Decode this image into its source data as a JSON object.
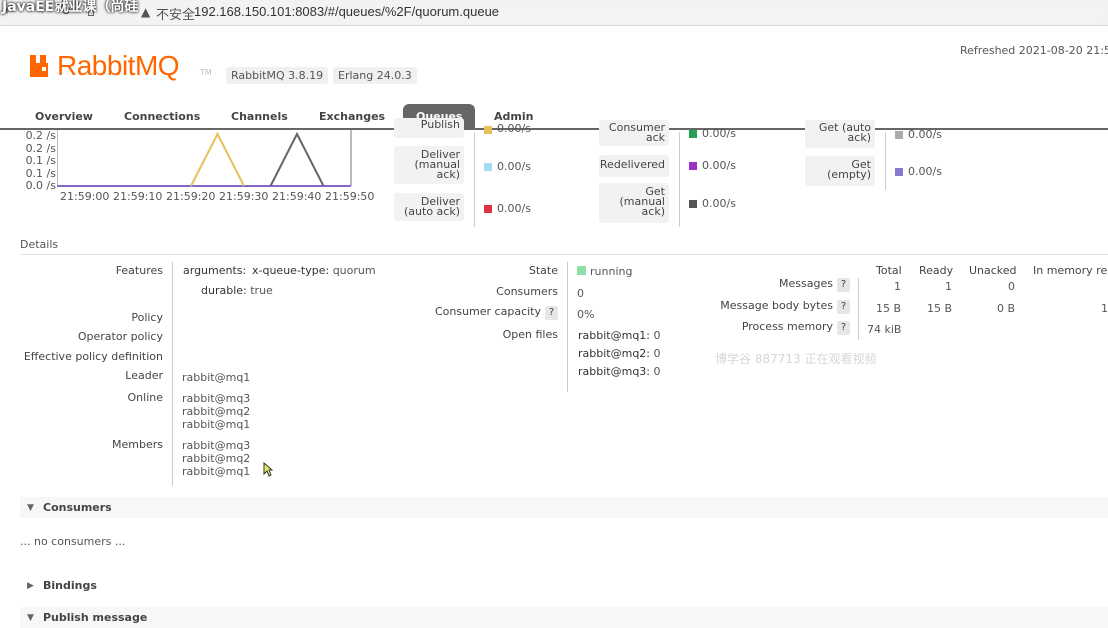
{
  "browser": {
    "overlay_text": "JavaEE就业课（尚硅",
    "security_text": "不安全",
    "url": "192.168.150.101:8083/#/queues/%2F/quorum.queue"
  },
  "header": {
    "brand": "RabbitMQ",
    "tm": "TM",
    "version_rabbit": "RabbitMQ 3.8.19",
    "version_erlang": "Erlang 24.0.3",
    "refreshed": "Refreshed 2021-08-20 21:5"
  },
  "tabs": [
    "Overview",
    "Connections",
    "Channels",
    "Exchanges",
    "Queues",
    "Admin"
  ],
  "active_tab": "Queues",
  "chart_data": {
    "type": "line",
    "y_ticks": [
      "0.2 /s",
      "0.2 /s",
      "0.1 /s",
      "0.1 /s",
      "0.0 /s"
    ],
    "x_ticks": [
      "21:59:00",
      "21:59:10",
      "21:59:20",
      "21:59:30",
      "21:59:40",
      "21:59:50"
    ],
    "series": [
      {
        "color": "#e6c25a",
        "points": [
          [
            "21:59:20",
            0.0
          ],
          [
            "21:59:25",
            0.2
          ],
          [
            "21:59:30",
            0.0
          ]
        ]
      },
      {
        "color": "#666666",
        "points": [
          [
            "21:59:35",
            0.0
          ],
          [
            "21:59:40",
            0.2
          ],
          [
            "21:59:45",
            0.0
          ]
        ]
      }
    ]
  },
  "rates": {
    "col1": [
      {
        "label": "Publish",
        "rate": "0.00/s",
        "color": "#e6c25a"
      },
      {
        "label": "Deliver (manual ack)",
        "rate": "0.00/s",
        "color": "#a6d8f2"
      },
      {
        "label": "Deliver (auto ack)",
        "rate": "0.00/s",
        "color": "#dd3344"
      }
    ],
    "col2": [
      {
        "label": "Consumer ack",
        "rate": "0.00/s",
        "color": "#22a055"
      },
      {
        "label": "Redelivered",
        "rate": "0.00/s",
        "color": "#9933cc"
      },
      {
        "label": "Get (manual ack)",
        "rate": "0.00/s",
        "color": "#555555"
      }
    ],
    "col3": [
      {
        "label": "Get (auto ack)",
        "rate": "0.00/s",
        "color": "#aaaaaa"
      },
      {
        "label": "Get (empty)",
        "rate": "0.00/s",
        "color": "#8877cc"
      }
    ]
  },
  "details": {
    "title": "Details",
    "features_label": "Features",
    "arguments_key": "arguments:",
    "queue_type_key": "x-queue-type:",
    "queue_type_val": "quorum",
    "durable_key": "durable:",
    "durable_val": "true",
    "policy_label": "Policy",
    "operator_policy_label": "Operator policy",
    "effective_policy_label": "Effective policy definition",
    "leader_label": "Leader",
    "leader_val": "rabbit@mq1",
    "online_label": "Online",
    "online": [
      "rabbit@mq3",
      "rabbit@mq2",
      "rabbit@mq1"
    ],
    "members_label": "Members",
    "members": [
      "rabbit@mq3",
      "rabbit@mq2",
      "rabbit@mq1"
    ],
    "state_label": "State",
    "state_val": "running",
    "consumers_label": "Consumers",
    "consumers_val": "0",
    "capacity_label": "Consumer capacity",
    "capacity_val": "0%",
    "open_files_label": "Open files",
    "open_files": [
      {
        "node": "rabbit@mq1:",
        "count": "0"
      },
      {
        "node": "rabbit@mq2:",
        "count": "0"
      },
      {
        "node": "rabbit@mq3:",
        "count": "0"
      }
    ],
    "help": "?"
  },
  "stats": {
    "headers": [
      "Total",
      "Ready",
      "Unacked",
      "In memory re"
    ],
    "messages_label": "Messages",
    "messages": [
      "1",
      "1",
      "0"
    ],
    "body_label": "Message body bytes",
    "body": [
      "15 B",
      "15 B",
      "0 B",
      "1"
    ],
    "memory_label": "Process memory",
    "memory": "74 kiB"
  },
  "watermark": "博学谷 887713 正在观看视频",
  "sections": {
    "consumers": "Consumers",
    "no_consumers": "... no consumers ...",
    "bindings": "Bindings",
    "publish": "Publish message"
  }
}
